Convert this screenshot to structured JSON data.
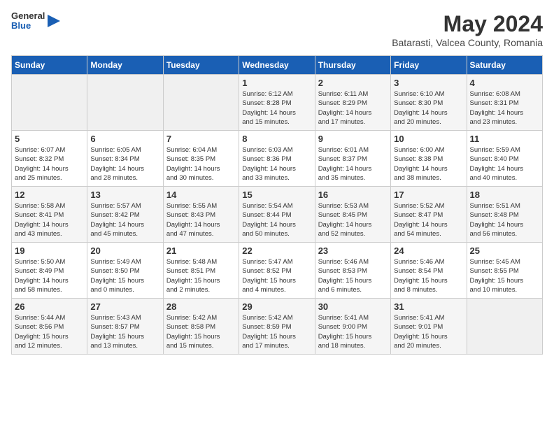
{
  "header": {
    "logo_general": "General",
    "logo_blue": "Blue",
    "title": "May 2024",
    "subtitle": "Batarasti, Valcea County, Romania"
  },
  "calendar": {
    "days_of_week": [
      "Sunday",
      "Monday",
      "Tuesday",
      "Wednesday",
      "Thursday",
      "Friday",
      "Saturday"
    ],
    "weeks": [
      [
        {
          "day": "",
          "empty": true
        },
        {
          "day": "",
          "empty": true
        },
        {
          "day": "",
          "empty": true
        },
        {
          "day": "1",
          "sunrise": "6:12 AM",
          "sunset": "8:28 PM",
          "daylight": "14 hours and 15 minutes."
        },
        {
          "day": "2",
          "sunrise": "6:11 AM",
          "sunset": "8:29 PM",
          "daylight": "14 hours and 17 minutes."
        },
        {
          "day": "3",
          "sunrise": "6:10 AM",
          "sunset": "8:30 PM",
          "daylight": "14 hours and 20 minutes."
        },
        {
          "day": "4",
          "sunrise": "6:08 AM",
          "sunset": "8:31 PM",
          "daylight": "14 hours and 23 minutes."
        }
      ],
      [
        {
          "day": "5",
          "sunrise": "6:07 AM",
          "sunset": "8:32 PM",
          "daylight": "14 hours and 25 minutes."
        },
        {
          "day": "6",
          "sunrise": "6:05 AM",
          "sunset": "8:34 PM",
          "daylight": "14 hours and 28 minutes."
        },
        {
          "day": "7",
          "sunrise": "6:04 AM",
          "sunset": "8:35 PM",
          "daylight": "14 hours and 30 minutes."
        },
        {
          "day": "8",
          "sunrise": "6:03 AM",
          "sunset": "8:36 PM",
          "daylight": "14 hours and 33 minutes."
        },
        {
          "day": "9",
          "sunrise": "6:01 AM",
          "sunset": "8:37 PM",
          "daylight": "14 hours and 35 minutes."
        },
        {
          "day": "10",
          "sunrise": "6:00 AM",
          "sunset": "8:38 PM",
          "daylight": "14 hours and 38 minutes."
        },
        {
          "day": "11",
          "sunrise": "5:59 AM",
          "sunset": "8:40 PM",
          "daylight": "14 hours and 40 minutes."
        }
      ],
      [
        {
          "day": "12",
          "sunrise": "5:58 AM",
          "sunset": "8:41 PM",
          "daylight": "14 hours and 43 minutes."
        },
        {
          "day": "13",
          "sunrise": "5:57 AM",
          "sunset": "8:42 PM",
          "daylight": "14 hours and 45 minutes."
        },
        {
          "day": "14",
          "sunrise": "5:55 AM",
          "sunset": "8:43 PM",
          "daylight": "14 hours and 47 minutes."
        },
        {
          "day": "15",
          "sunrise": "5:54 AM",
          "sunset": "8:44 PM",
          "daylight": "14 hours and 50 minutes."
        },
        {
          "day": "16",
          "sunrise": "5:53 AM",
          "sunset": "8:45 PM",
          "daylight": "14 hours and 52 minutes."
        },
        {
          "day": "17",
          "sunrise": "5:52 AM",
          "sunset": "8:47 PM",
          "daylight": "14 hours and 54 minutes."
        },
        {
          "day": "18",
          "sunrise": "5:51 AM",
          "sunset": "8:48 PM",
          "daylight": "14 hours and 56 minutes."
        }
      ],
      [
        {
          "day": "19",
          "sunrise": "5:50 AM",
          "sunset": "8:49 PM",
          "daylight": "14 hours and 58 minutes."
        },
        {
          "day": "20",
          "sunrise": "5:49 AM",
          "sunset": "8:50 PM",
          "daylight": "15 hours and 0 minutes."
        },
        {
          "day": "21",
          "sunrise": "5:48 AM",
          "sunset": "8:51 PM",
          "daylight": "15 hours and 2 minutes."
        },
        {
          "day": "22",
          "sunrise": "5:47 AM",
          "sunset": "8:52 PM",
          "daylight": "15 hours and 4 minutes."
        },
        {
          "day": "23",
          "sunrise": "5:46 AM",
          "sunset": "8:53 PM",
          "daylight": "15 hours and 6 minutes."
        },
        {
          "day": "24",
          "sunrise": "5:46 AM",
          "sunset": "8:54 PM",
          "daylight": "15 hours and 8 minutes."
        },
        {
          "day": "25",
          "sunrise": "5:45 AM",
          "sunset": "8:55 PM",
          "daylight": "15 hours and 10 minutes."
        }
      ],
      [
        {
          "day": "26",
          "sunrise": "5:44 AM",
          "sunset": "8:56 PM",
          "daylight": "15 hours and 12 minutes."
        },
        {
          "day": "27",
          "sunrise": "5:43 AM",
          "sunset": "8:57 PM",
          "daylight": "15 hours and 13 minutes."
        },
        {
          "day": "28",
          "sunrise": "5:42 AM",
          "sunset": "8:58 PM",
          "daylight": "15 hours and 15 minutes."
        },
        {
          "day": "29",
          "sunrise": "5:42 AM",
          "sunset": "8:59 PM",
          "daylight": "15 hours and 17 minutes."
        },
        {
          "day": "30",
          "sunrise": "5:41 AM",
          "sunset": "9:00 PM",
          "daylight": "15 hours and 18 minutes."
        },
        {
          "day": "31",
          "sunrise": "5:41 AM",
          "sunset": "9:01 PM",
          "daylight": "15 hours and 20 minutes."
        },
        {
          "day": "",
          "empty": true
        }
      ]
    ]
  }
}
